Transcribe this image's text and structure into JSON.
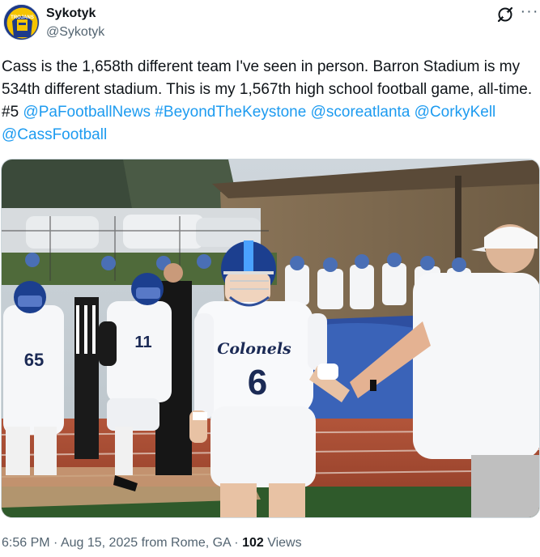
{
  "author": {
    "name": "Sykotyk",
    "handle": "@Sykotyk",
    "avatar_label": "TROJANS"
  },
  "tweet": {
    "segments": [
      {
        "type": "text",
        "text": "Cass is the 1,658th different team I've seen in person. Barron Stadium is my 534th different stadium. This is my 1,567th high school football game, all-time. #5 "
      },
      {
        "type": "mention",
        "text": "@PaFootballNews"
      },
      {
        "type": "text",
        "text": " "
      },
      {
        "type": "hashtag",
        "text": "#BeyondTheKeystone"
      },
      {
        "type": "text",
        "text": " "
      },
      {
        "type": "mention",
        "text": "@scoreatlanta"
      },
      {
        "type": "text",
        "text": " "
      },
      {
        "type": "mention",
        "text": "@CorkyKell"
      },
      {
        "type": "text",
        "text": " "
      },
      {
        "type": "mention",
        "text": "@CassFootball"
      }
    ]
  },
  "photo": {
    "jersey_script": "Colonels",
    "jersey_number": "6",
    "left_player_number": "65",
    "mid_player_number": "11"
  },
  "footer": {
    "time": "6:56 PM",
    "separator1": " · ",
    "date": "Aug 15, 2025",
    "location": " from Rome, GA",
    "separator2": " · ",
    "views_count": "102",
    "views_label": " Views"
  },
  "icons": {
    "grok": "grok-icon",
    "more": "more-icon"
  },
  "colors": {
    "link": "#1d9bf0",
    "secondary_text": "#536471",
    "primary_text": "#0f1419"
  }
}
